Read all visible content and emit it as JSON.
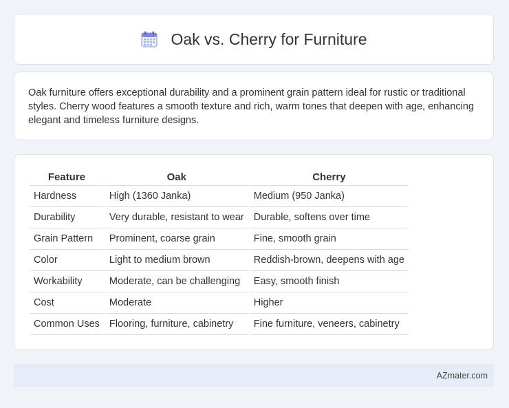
{
  "header": {
    "title": "Oak vs. Cherry for Furniture",
    "icon": "calendar-icon"
  },
  "summary": {
    "text": "Oak furniture offers exceptional durability and a prominent grain pattern ideal for rustic or traditional styles. Cherry wood features a smooth texture and rich, warm tones that deepen with age, enhancing elegant and timeless furniture designs."
  },
  "table": {
    "headers": [
      "Feature",
      "Oak",
      "Cherry"
    ],
    "rows": [
      [
        "Hardness",
        "High (1360 Janka)",
        "Medium (950 Janka)"
      ],
      [
        "Durability",
        "Very durable, resistant to wear",
        "Durable, softens over time"
      ],
      [
        "Grain Pattern",
        "Prominent, coarse grain",
        "Fine, smooth grain"
      ],
      [
        "Color",
        "Light to medium brown",
        "Reddish-brown, deepens with age"
      ],
      [
        "Workability",
        "Moderate, can be challenging",
        "Easy, smooth finish"
      ],
      [
        "Cost",
        "Moderate",
        "Higher"
      ],
      [
        "Common Uses",
        "Flooring, furniture, cabinetry",
        "Fine furniture, veneers, cabinetry"
      ]
    ]
  },
  "footer": {
    "site": "AZmater.com"
  }
}
